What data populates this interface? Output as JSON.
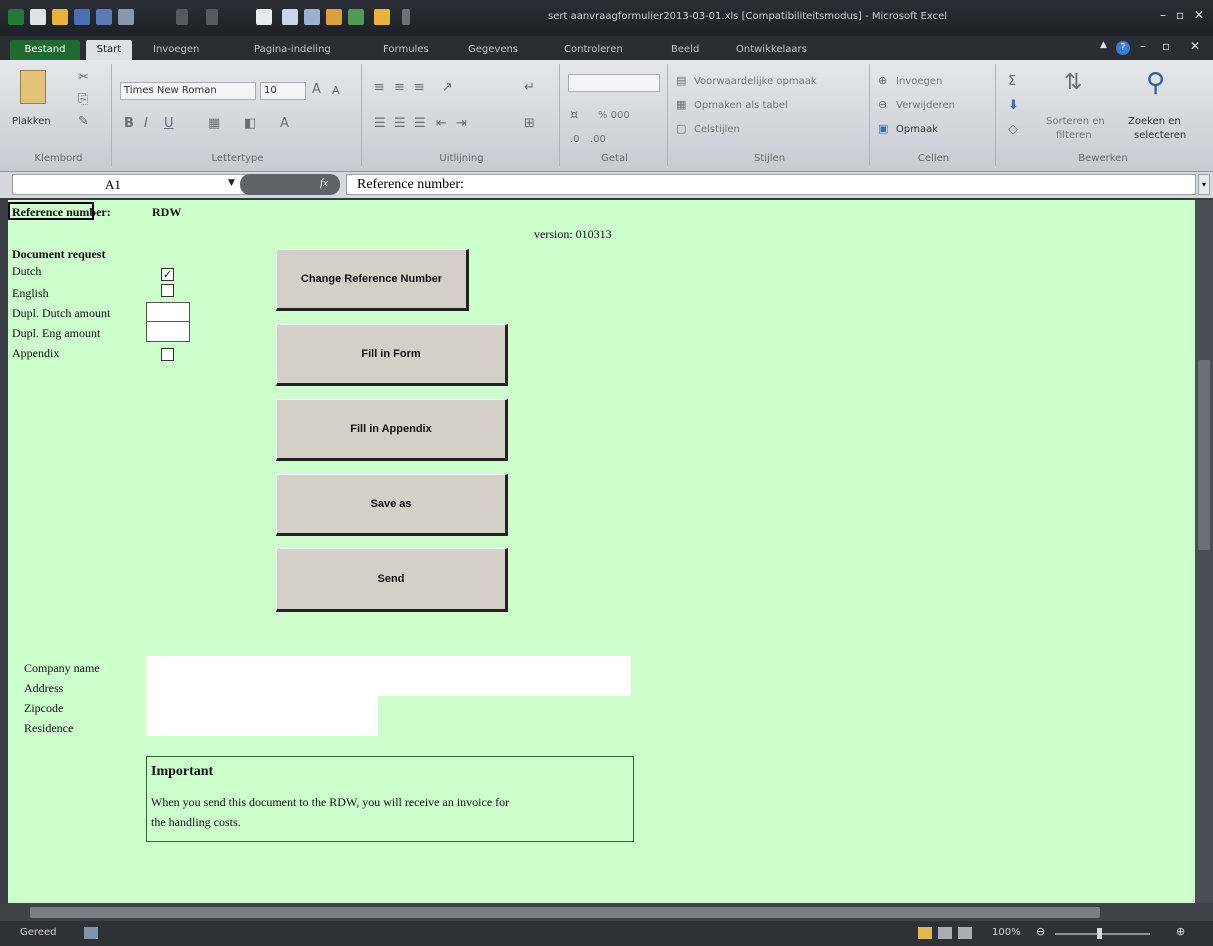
{
  "window": {
    "title": "sert aanvraagformulier2013-03-01.xls [Compatibiliteitsmodus] - Microsoft Excel"
  },
  "ribbon_tabs": [
    "Bestand",
    "Start",
    "Invoegen",
    "Pagina-indeling",
    "Formules",
    "Gegevens",
    "Controleren",
    "Beeld",
    "Ontwikkelaars"
  ],
  "ribbon": {
    "clipboard": {
      "paste_label": "Plakken",
      "group_label": "Klembord"
    },
    "font": {
      "name": "Times New Roman",
      "size": "10",
      "group_label": "Lettertype"
    },
    "alignment": {
      "group_label": "Uitlijning"
    },
    "number": {
      "format_symbols": "% 000",
      "group_label": "Getal"
    },
    "styles": {
      "conditional": "Voorwaardelijke opmaak",
      "as_table": "Opmaken als tabel",
      "cell_styles": "Celstijlen",
      "group_label": "Stijlen"
    },
    "cells": {
      "insert": "Invoegen",
      "delete": "Verwijderen",
      "format": "Opmaak",
      "group_label": "Cellen"
    },
    "editing": {
      "sort_line1": "Sorteren en",
      "sort_line2": "filteren",
      "find_line1": "Zoeken en",
      "find_line2": "selecteren",
      "group_label": "Bewerken"
    }
  },
  "formula_bar": {
    "name_box": "A1",
    "fx_label": "fx",
    "value": "Reference number:"
  },
  "sheet": {
    "reference_label": "Reference number:",
    "reference_value": "RDW",
    "version": "version: 010313",
    "document_request_title": "Document request",
    "requests": {
      "dutch": "Dutch",
      "english": "English",
      "dupl_dutch": "Dupl. Dutch amount",
      "dupl_eng": "Dupl. Eng amount",
      "appendix": "Appendix"
    },
    "dutch_checked": "✓",
    "buttons": {
      "change_ref": "Change Reference Number",
      "fill_form": "Fill in Form",
      "fill_appendix": "Fill in Appendix",
      "save_as": "Save as",
      "send": "Send"
    },
    "address": {
      "company_name": "Company name",
      "address": "Address",
      "zipcode": "Zipcode",
      "residence": "Residence"
    },
    "important": {
      "title": "Important",
      "body_line1": "When you send this document to the RDW, you will receive an invoice for",
      "body_line2": "the handling costs."
    }
  },
  "status_bar": {
    "status": "Gereed",
    "zoom": "100%"
  },
  "colors": {
    "sheet_background": "#ccffcc",
    "button_face": "#d4d0c8",
    "file_tab": "#1f6b2f"
  }
}
